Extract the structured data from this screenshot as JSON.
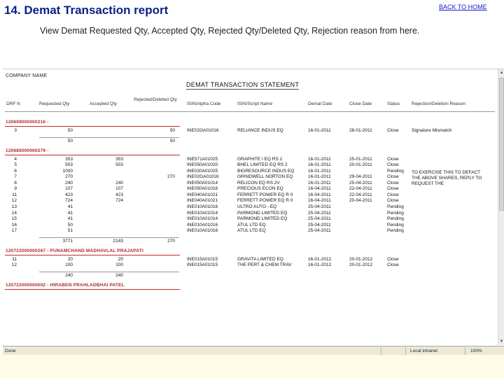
{
  "slide": {
    "title": "14. Demat Transaction report",
    "back_link": "BACK TO HOME",
    "description": "View Demat Requested Qty, Accepted Qty, Rejected Qty/Deleted Qty, Rejection reason from here."
  },
  "report": {
    "company_label": "COMPANY NAME",
    "statement_title": "DEMAT TRANSACTION STATEMENT",
    "columns": [
      "DRF N",
      "Requested Qty",
      "Accepted Qty",
      "Rejected/Deleted Qty",
      "ISIN/Alpha Code",
      "ISIN/Script Name",
      "Demat Date",
      "Close Date",
      "Status",
      "Rejection/Deletion Reason"
    ],
    "groups": [
      {
        "label": "120609000000216 -",
        "rows": [
          [
            "3",
            "50",
            "",
            "50",
            "INE02GA01016",
            "RELIANCE INDUS EQ",
            "16-01-2011",
            "28-01-2011",
            "Close",
            "Signature Mismatch"
          ]
        ],
        "totals": [
          "",
          "50",
          "",
          "50"
        ]
      },
      {
        "label": "120680000000279 -",
        "rows": [
          [
            "4",
            "353",
            "353",
            "",
            "INE571A01025",
            "GRAPHITE I EQ RS 2",
            "16-01-2011",
            "25-01-2011",
            "Close",
            ""
          ],
          [
            "5",
            "503",
            "503",
            "",
            "INE050A01020",
            "BHEL LIMITED EQ RS 2",
            "16-01-2011",
            "20-01-2011",
            "Close",
            ""
          ],
          [
            "6",
            "1000",
            "",
            "",
            "INE020A01025",
            "BIGRESOURCE INDUS EQ",
            "16-01-2011",
            "",
            "Pending",
            ""
          ],
          [
            "7",
            "270",
            "",
            "270",
            "INE02GA01016",
            "GRINDWELL NORTON EQ",
            "16-01-2011",
            "29-04-2011",
            "Close",
            "TO EXERCISE THIS TO DEFACT THE ABOVE SHARES, REPLY TO REQUEST THE"
          ],
          [
            "8",
            "240",
            "240",
            "",
            "INE050A01014",
            "RELICON EQ RS 2V",
            "16-01-2011",
            "25-04-2011",
            "Close",
            ""
          ],
          [
            "9",
            "107",
            "107",
            "",
            "INE050A01016",
            "PRECIOUS ECON EQ",
            "16-04-2011",
            "22-04-2011",
            "Close",
            ""
          ],
          [
            "11",
            "423",
            "423",
            "",
            "INE040A01021",
            "FERRETT POWER EQ R 0",
            "16-04-2011",
            "22-04-2011",
            "Close",
            ""
          ],
          [
            "12",
            "724",
            "724",
            "",
            "INE040A01021",
            "FERRETT POWER EQ R 0",
            "16-04-2011",
            "20-04-2011",
            "Close",
            ""
          ],
          [
            "13",
            "41",
            "",
            "",
            "INE010A01016",
            "ULTRO AUTO - EQ",
            "25-04-2011",
            "",
            "Pending",
            ""
          ],
          [
            "14",
            "41",
            "",
            "",
            "INE010A01014",
            "PARMOND LIMITED EQ",
            "25-04-2011",
            "",
            "Pending",
            ""
          ],
          [
            "15",
            "41",
            "",
            "",
            "INE010A01014",
            "PARMOND LIMITED EQ",
            "25-04-2011",
            "",
            "Pending",
            ""
          ],
          [
            "16",
            "50",
            "",
            "",
            "INE010A01016",
            "ATUL LTD EQ",
            "25-04-2011",
            "",
            "Pending",
            ""
          ],
          [
            "17",
            "51",
            "",
            "",
            "INE010A01016",
            "ATUL LTD EQ",
            "25-04-2011",
            "",
            "Pending",
            ""
          ]
        ],
        "totals": [
          "",
          "3771",
          "2143",
          "270"
        ]
      },
      {
        "label": "120722000000267 - PUNAMCHAND MADHAVLAL PRAJAPATI",
        "rows": [
          [
            "11",
            "20",
            "20",
            "",
            "INE015A01015",
            "GRAVITA LIMITED EQ",
            "16-01-2012",
            "20-01-2012",
            "Close",
            ""
          ],
          [
            "12",
            "100",
            "100",
            "",
            "INE015A01015",
            "THE PERT & CHEM TRAV",
            "16-01-2012",
            "20-01-2012",
            "Close",
            ""
          ]
        ],
        "totals": [
          "",
          "240",
          "240",
          ""
        ]
      },
      {
        "label": "120722000000002 - HIRABEN PRAHLADBHAI PATEL",
        "rows": [],
        "totals": []
      }
    ]
  },
  "browser": {
    "status_left": "Done",
    "zone": "Local intranet",
    "zoom": "100%"
  },
  "colors": {
    "title": "#0b1f86",
    "group_label": "#b3242a",
    "link": "#1616c8"
  }
}
